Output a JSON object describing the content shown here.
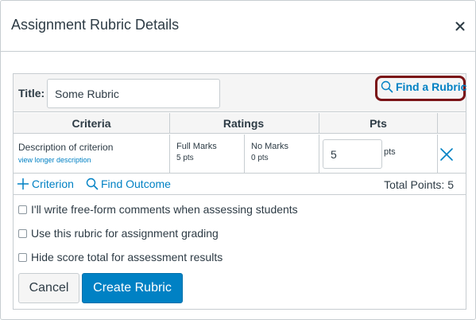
{
  "dialog": {
    "title": "Assignment Rubric Details",
    "close_icon": "close-icon"
  },
  "rubric": {
    "title_label": "Title:",
    "title_value": "Some Rubric",
    "find_rubric_label": "Find a Rubric",
    "find_rubric_icon": "search-icon",
    "columns": [
      "Criteria",
      "Ratings",
      "Pts"
    ],
    "criterion": {
      "description": "Description of criterion",
      "view_longer": "view longer description",
      "ratings": [
        {
          "name": "Full Marks",
          "points": "5 pts"
        },
        {
          "name": "No Marks",
          "points": "0 pts"
        }
      ],
      "points_value": "5",
      "points_suffix": "pts",
      "delete_icon": "close-icon"
    },
    "add_criterion_label": "Criterion",
    "find_outcome_label": "Find Outcome",
    "total_points": "Total Points: 5"
  },
  "options": [
    {
      "label": "I'll write free-form comments when assessing students",
      "checked": false
    },
    {
      "label": "Use this rubric for assignment grading",
      "checked": false
    },
    {
      "label": "Hide score total for assessment results",
      "checked": false
    }
  ],
  "buttons": {
    "cancel": "Cancel",
    "create": "Create Rubric"
  },
  "colors": {
    "link": "#0081c4",
    "primary_button": "#0081c4",
    "highlight_border": "#7a1417",
    "header_bg": "#f5f5f5",
    "border": "#c7cdd1"
  }
}
